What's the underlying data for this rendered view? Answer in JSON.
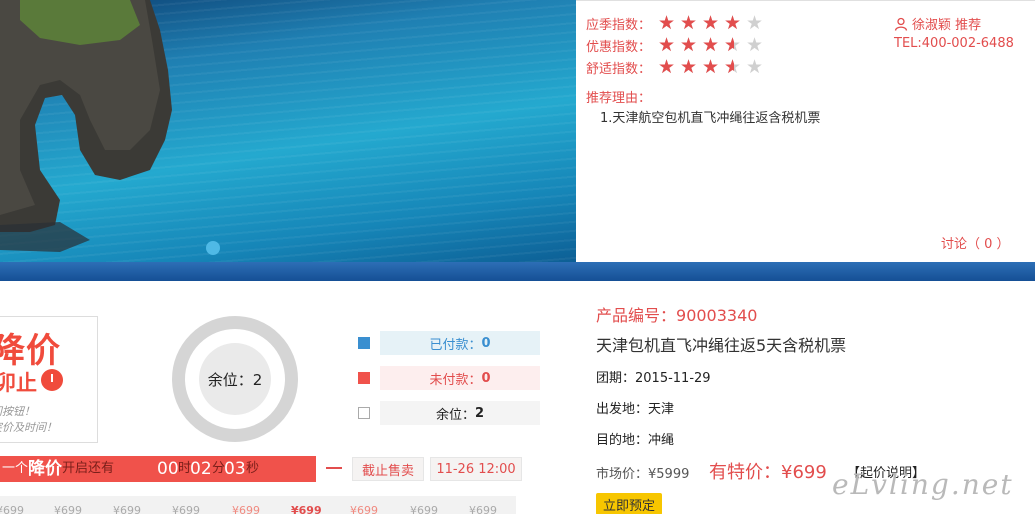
{
  "ratings": [
    {
      "label": "应季指数：",
      "stars": 4
    },
    {
      "label": "优惠指数：",
      "stars": 3.5
    },
    {
      "label": "舒适指数：",
      "stars": 3.5
    }
  ],
  "recommender": "徐淑颖 推荐",
  "tel": "TEL:400-002-6488",
  "reason_label": "推荐理由：",
  "reason_item": "1.天津航空包机直飞冲绳往返含税机票",
  "discuss": "讨论（ 0 ）",
  "promo": {
    "big": "降价",
    "mid": "卯止",
    "line1": "间按钮！",
    "line2": "突价及时间！"
  },
  "seats_circle": "余位：2",
  "legend": [
    {
      "label": "已付款：",
      "value": "0",
      "color": "#3a8fd0",
      "bg": "#e6f2f7",
      "text_color": "#3a8fd0"
    },
    {
      "label": "未付款：",
      "value": "0",
      "color": "#f0524b",
      "bg": "#fdeeee",
      "text_color": "#e24d4d"
    },
    {
      "label": "余位：",
      "value": "2",
      "color": "#ffffff",
      "bg": "#f4f4f4",
      "text_color": "#222"
    }
  ],
  "countdown": {
    "prefix": "一个",
    "word": "降价",
    "suffix": "开启还有",
    "hours": "00",
    "h_unit": "时",
    "minutes": "02",
    "m_unit": "分",
    "seconds": "03",
    "s_unit": "秒"
  },
  "stop_sale": "截止售卖",
  "deadline": "11-26 12:00",
  "price_strip": [
    "¥699",
    "¥699",
    "¥699",
    "¥699",
    "¥699",
    "¥699",
    "¥699",
    "¥699",
    "¥699"
  ],
  "product": {
    "id_label": "产品编号：",
    "id": "90003340",
    "title": "天津包机直飞冲绳往返5天含税机票",
    "group_label": "团期：",
    "group": "2015-11-29",
    "depart_label": "出发地：",
    "depart": "天津",
    "dest_label": "目的地：",
    "dest": "冲绳",
    "market_label": "市场价：",
    "market": "¥5999",
    "special_label": "有特价：",
    "special": "¥699",
    "explain": "【起价说明】",
    "book": "立即预定"
  },
  "watermark": "eLvling.net",
  "colors": {
    "accent": "#e24d4d",
    "blue_bar": "#1f5ea6",
    "book": "#f7c600"
  }
}
